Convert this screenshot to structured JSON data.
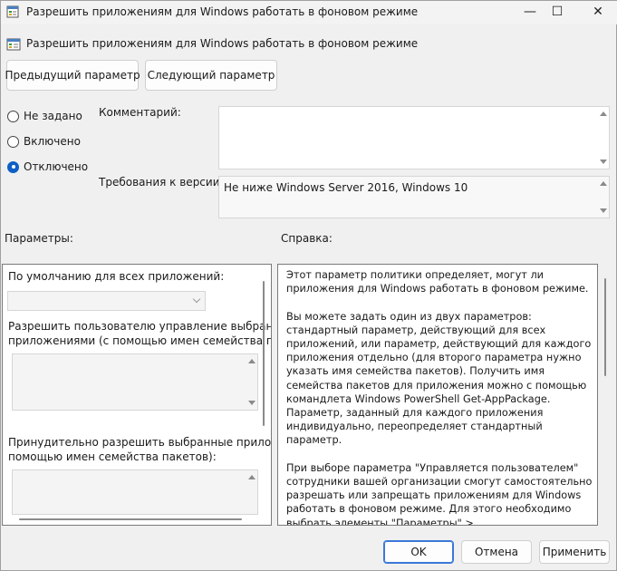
{
  "window": {
    "title": "Разрешить приложениям для Windows работать в фоновом режиме",
    "minimize_glyph": "—",
    "maximize_glyph": "☐",
    "close_glyph": "✕"
  },
  "header": {
    "title": "Разрешить приложениям для Windows работать в фоновом режиме",
    "icon": "policy-setting-icon"
  },
  "nav": {
    "prev_label": "Предыдущий параметр",
    "next_label": "Следующий параметр"
  },
  "state": {
    "options": [
      {
        "label": "Не задано",
        "checked": false
      },
      {
        "label": "Включено",
        "checked": false
      },
      {
        "label": "Отключено",
        "checked": true
      }
    ]
  },
  "comment": {
    "label": "Комментарий:",
    "value": ""
  },
  "version": {
    "label": "Требования к версии:",
    "value": "Не ниже Windows Server 2016, Windows 10"
  },
  "params": {
    "label": "Параметры:",
    "default_label": "По умолчанию для всех приложений:",
    "default_value": "",
    "user_control_label_1": "Разрешить пользователю управление выбранными",
    "user_control_label_2": "приложениями (с помощью имен семейства пакет",
    "force_allow_label_1": "Принудительно разрешить выбранные приложен",
    "force_allow_label_2": "помощью имен семейства пакетов):"
  },
  "help": {
    "label": "Справка:",
    "paragraphs": [
      "Этот параметр политики определяет, могут ли приложения для Windows работать в фоновом режиме.",
      "Вы можете задать один из двух параметров: стандартный параметр, действующий для всех приложений, или параметр, действующий для каждого приложения отдельно (для второго параметра нужно указать имя семейства пакетов). Получить имя семейства пакетов для приложения можно с помощью командлета Windows PowerShell Get-AppPackage. Параметр, заданный для каждого приложения индивидуально, переопределяет стандартный параметр.",
      "При выборе параметра \"Управляется пользователем\" сотрудники вашей организации смогут самостоятельно разрешать или запрещать приложениям для Windows работать в фоновом режиме. Для этого необходимо выбрать элементы \"Параметры\" > \"Конфиденциальность\" на устройстве."
    ]
  },
  "footer": {
    "ok_label": "OK",
    "cancel_label": "Отмена",
    "apply_label": "Применить"
  },
  "colors": {
    "accent": "#0f5fc5",
    "primary_border": "#3b78d8",
    "background": "#f0f0f0"
  }
}
